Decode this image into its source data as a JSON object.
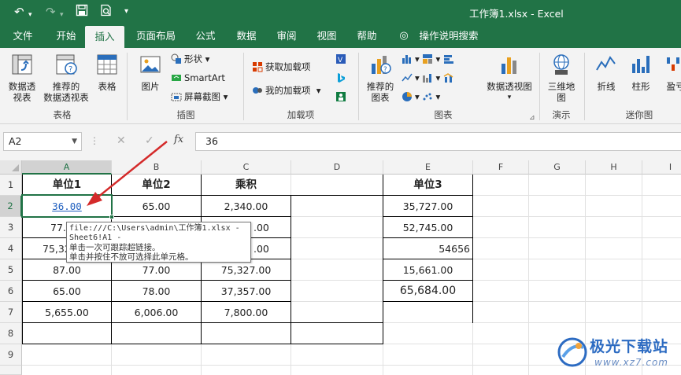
{
  "titlebar": {
    "title": "工作簿1.xlsx  -  Excel",
    "icons": [
      "undo-icon",
      "redo-icon",
      "save-icon",
      "print-preview-icon",
      "customize-qat-icon"
    ]
  },
  "tabs": [
    "文件",
    "开始",
    "插入",
    "页面布局",
    "公式",
    "数据",
    "审阅",
    "视图",
    "帮助",
    "操作说明搜索"
  ],
  "active_tab": "插入",
  "ribbon": {
    "tables": {
      "pivot": "数据透\n视表",
      "recommended_pivot": "推荐的\n数据透视表",
      "table": "表格",
      "group": "表格"
    },
    "illustrations": {
      "pictures": "图片",
      "shapes": "形状",
      "smartart": "SmartArt",
      "screenshot": "屏幕截图",
      "group": "插图"
    },
    "addins": {
      "get": "获取加载项",
      "my": "我的加载项",
      "group": "加载项"
    },
    "charts": {
      "recommended": "推荐的\n图表",
      "pivot_chart": "数据透视图",
      "group": "图表"
    },
    "tours": {
      "map3d": "三维地\n图",
      "group": "演示"
    },
    "sparklines": {
      "line": "折线",
      "column": "柱形",
      "winloss": "盈亏",
      "group": "迷你图"
    }
  },
  "formula_bar": {
    "name_box": "A2",
    "value": "36",
    "fx": "fx"
  },
  "columns": [
    "A",
    "B",
    "C",
    "D",
    "E",
    "F",
    "G",
    "H",
    "I"
  ],
  "rows": [
    "1",
    "2",
    "3",
    "4",
    "5",
    "6",
    "7",
    "8",
    "9"
  ],
  "cells": {
    "A1": "单位1",
    "B1": "单位2",
    "C1": "乘积",
    "E1": "单位3",
    "A2": "36.00",
    "B2": "65.00",
    "C2": "2,340.00",
    "E2": "35,727.00",
    "A3": "77.",
    "C3": ".00",
    "E3": "52,745.00",
    "A4": "75,32",
    "C4": ".00",
    "E4": "54656",
    "A5": "87.00",
    "B5": "77.00",
    "C5": "75,327.00",
    "E5": "15,661.00",
    "A6": "65.00",
    "B6": "78.00",
    "C6": "37,357.00",
    "E6": "65,684.00",
    "A7": "5,655.00",
    "B7": "6,006.00",
    "C7": "7,800.00"
  },
  "tooltip": {
    "line1": "file:///C:\\Users\\admin\\工作簿1.xlsx - ",
    "line2": "Sheet6!A1 -",
    "line3": "单击一次可跟踪超链接。",
    "line4": "单击并按住不放可选择此单元格。"
  },
  "watermark": {
    "text": "极光下载站",
    "url": "www.xz7.com"
  },
  "colors": {
    "excel_green": "#217346",
    "link_blue": "#1f5fbf",
    "arrow_red": "#d42a2a"
  }
}
